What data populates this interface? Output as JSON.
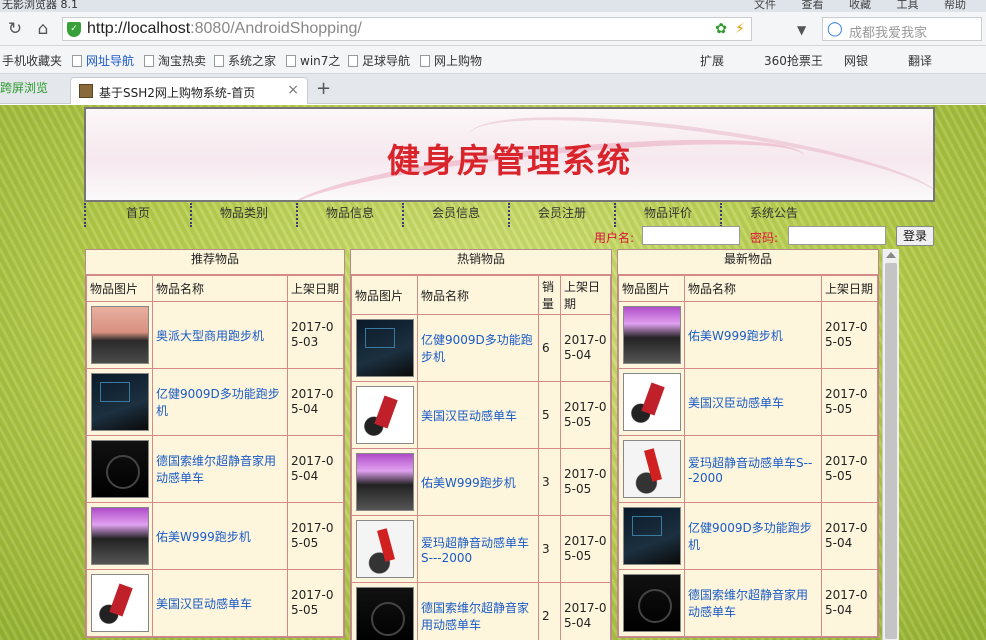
{
  "browser": {
    "title": "无影浏览器 8.1",
    "menus": [
      "文件",
      "查看",
      "收藏",
      "工具",
      "帮助"
    ],
    "url_host": "http://localhost",
    "url_path": ":8080/AndroidShopping/",
    "search_placeholder": "成都我爱我家",
    "favorites": [
      "手机收藏夹",
      "网址导航",
      "淘宝热卖",
      "系统之家",
      "win7之",
      "足球导航",
      "网上购物"
    ],
    "extensions": [
      "扩展",
      "360抢票王",
      "网银",
      "翻译"
    ],
    "left_tab": "跨屏浏览",
    "active_tab": "基于SSH2网上购物系统-首页"
  },
  "site": {
    "banner_title": "健身房管理系统",
    "nav": [
      "首页",
      "物品类别",
      "物品信息",
      "会员信息",
      "会员注册",
      "物品评价",
      "系统公告"
    ],
    "login": {
      "username_label": "用户名:",
      "password_label": "密码:",
      "button": "登录"
    }
  },
  "recommended": {
    "title": "推荐物品",
    "headers": [
      "物品图片",
      "物品名称",
      "上架日期"
    ],
    "rows": [
      {
        "name": "奥派大型商用跑步机",
        "date": "2017-05-03",
        "date_display": "2017-0\n5-03",
        "thumb": "gym"
      },
      {
        "name": "亿健9009D多功能跑步机",
        "date": "2017-05-04",
        "date_display": "2017-0\n5-04",
        "thumb": "dark"
      },
      {
        "name": "德国索维尔超静音家用动感单车",
        "date": "2017-05-04",
        "date_display": "2017-0\n5-04",
        "thumb": "black"
      },
      {
        "name": "佑美W999跑步机",
        "date": "2017-05-05",
        "date_display": "2017-0\n5-05",
        "thumb": "purple"
      },
      {
        "name": "美国汉臣动感单车",
        "date": "2017-05-05",
        "date_display": "2017-0\n5-05",
        "thumb": "bike"
      }
    ]
  },
  "hot": {
    "title": "热销物品",
    "headers": [
      "物品图片",
      "物品名称",
      "销量",
      "上架日期"
    ],
    "rows": [
      {
        "name": "亿健9009D多功能跑步机",
        "sales": "6",
        "date_display": "2017-0\n5-04",
        "thumb": "dark"
      },
      {
        "name": "美国汉臣动感单车",
        "sales": "5",
        "date_display": "2017-0\n5-05",
        "thumb": "bike"
      },
      {
        "name": "佑美W999跑步机",
        "sales": "3",
        "date_display": "2017-0\n5-05",
        "thumb": "purple"
      },
      {
        "name": "爱玛超静音动感单车S---2000",
        "sales": "3",
        "date_display": "2017-0\n5-05",
        "thumb": "bike2"
      },
      {
        "name": "德国索维尔超静音家用动感单车",
        "sales": "2",
        "date_display": "2017-0\n5-04",
        "thumb": "black"
      }
    ]
  },
  "latest": {
    "title": "最新物品",
    "headers": [
      "物品图片",
      "物品名称",
      "上架日期"
    ],
    "rows": [
      {
        "name": "佑美W999跑步机",
        "date_display": "2017-0\n5-05",
        "thumb": "purple"
      },
      {
        "name": "美国汉臣动感单车",
        "date_display": "2017-0\n5-05",
        "thumb": "bike"
      },
      {
        "name": "爱玛超静音动感单车S---2000",
        "date_display": "2017-0\n5-05",
        "thumb": "bike2"
      },
      {
        "name": "亿健9009D多功能跑步机",
        "date_display": "2017-0\n5-04",
        "thumb": "dark"
      },
      {
        "name": "德国索维尔超静音家用动感单车",
        "date_display": "2017-0\n5-04",
        "thumb": "black"
      }
    ]
  }
}
